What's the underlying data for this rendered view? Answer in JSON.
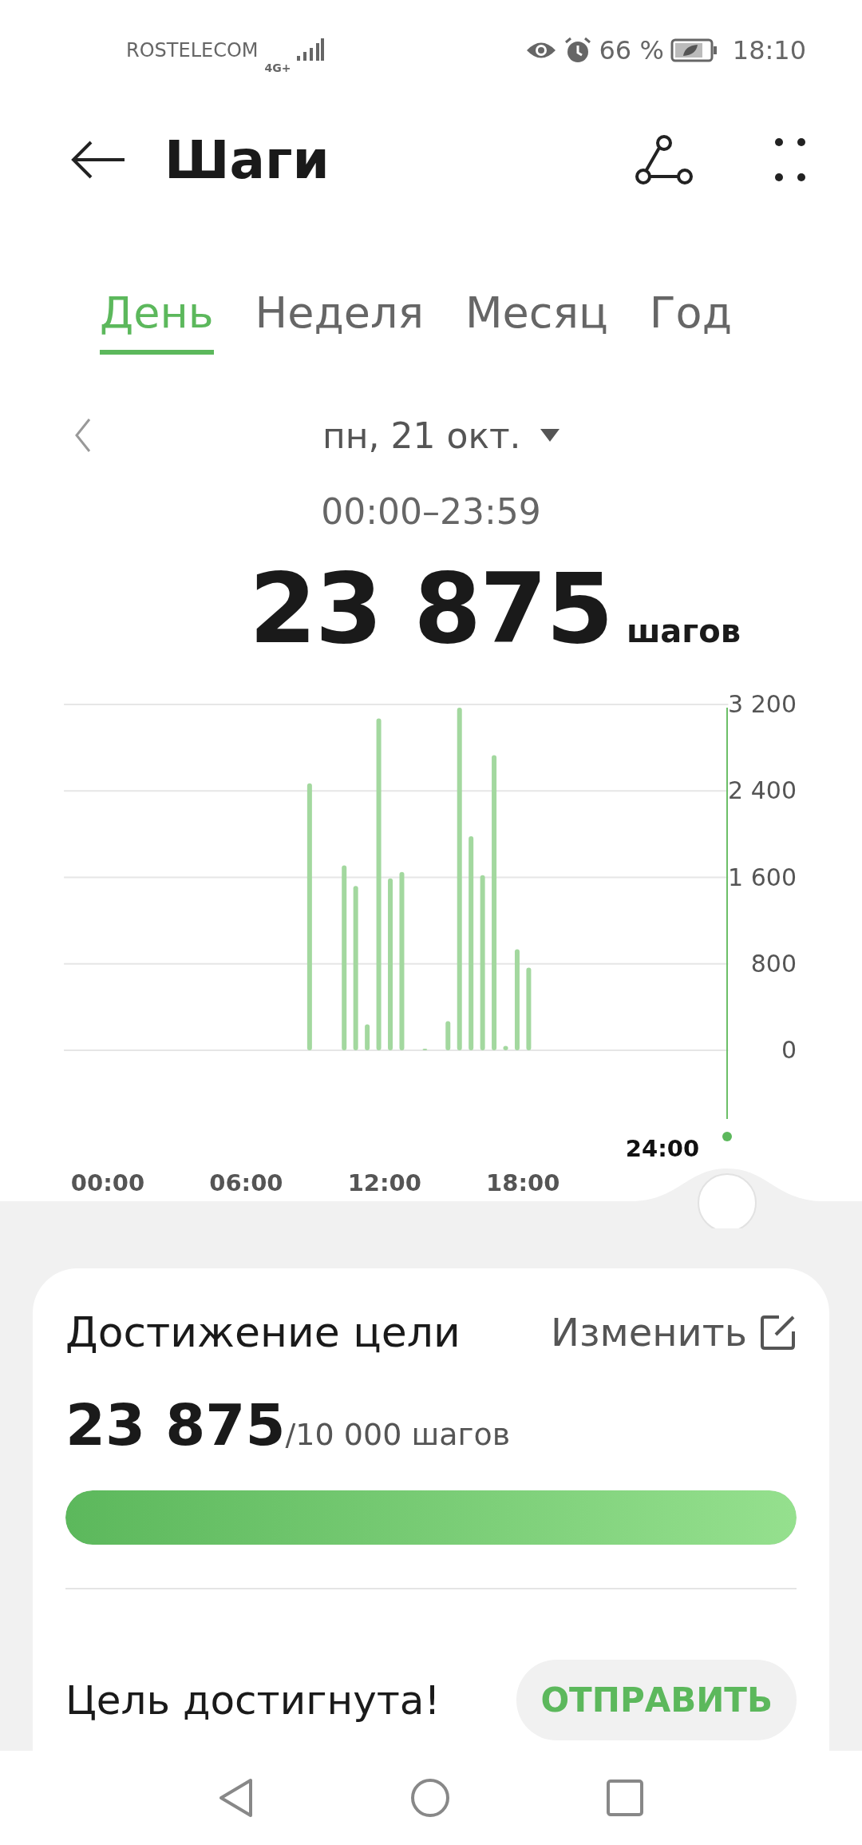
{
  "status_bar": {
    "carrier": "ROSTELECOM",
    "network": "4G+",
    "battery": "66 %",
    "time": "18:10"
  },
  "header": {
    "title": "Шаги"
  },
  "tabs": [
    {
      "label": "День",
      "selected": true
    },
    {
      "label": "Неделя",
      "selected": false
    },
    {
      "label": "Месяц",
      "selected": false
    },
    {
      "label": "Год",
      "selected": false
    }
  ],
  "date": {
    "label": "пн, 21 окт.",
    "range": "00:00–23:59"
  },
  "total": {
    "value": "23 875",
    "unit": "шагов"
  },
  "chart_data": {
    "type": "bar",
    "grid": true,
    "x": [
      8.75,
      10.25,
      10.75,
      11.25,
      11.75,
      12.25,
      12.75,
      13.75,
      14.75,
      15.25,
      15.75,
      16.25,
      16.75,
      17.25,
      17.75,
      18.25
    ],
    "values": [
      2470,
      1710,
      1520,
      240,
      3070,
      1590,
      1650,
      15,
      270,
      3170,
      1980,
      1620,
      2730,
      40,
      935,
      765
    ],
    "xlim": [
      -1.9,
      26.9
    ],
    "ylim": [
      0,
      3200
    ],
    "xticks": [
      {
        "value": 0,
        "label": "00:00"
      },
      {
        "value": 6,
        "label": "06:00"
      },
      {
        "value": 12,
        "label": "12:00"
      },
      {
        "value": 18,
        "label": "18:00"
      }
    ],
    "yticks": [
      {
        "value": 0,
        "label": "0"
      },
      {
        "value": 800,
        "label": "800"
      },
      {
        "value": 1600,
        "label": "1 600"
      },
      {
        "value": 2400,
        "label": "2 400"
      },
      {
        "value": 3200,
        "label": "3 200"
      }
    ]
  },
  "cursor_label": "24:00",
  "goal": {
    "title": "Достижение цели",
    "edit": "Изменить",
    "value": "23 875",
    "target": "/10 000 шагов",
    "level": 1,
    "status": "Цель достигнута!",
    "share": "ОТПРАВИТЬ"
  }
}
